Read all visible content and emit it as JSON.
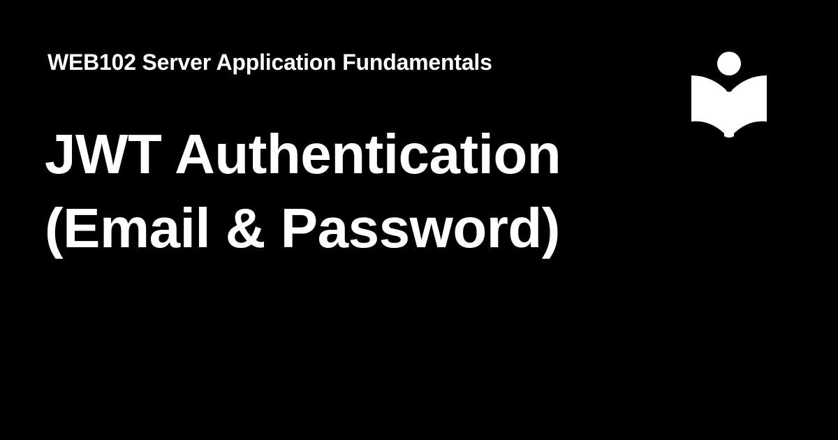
{
  "card": {
    "background_color": "#000000",
    "text_color": "#ffffff",
    "course_title": "WEB102 Server Application Fundamentals",
    "lesson_title": {
      "line1": "JWT Authentication",
      "line2": "(Email & Password)"
    },
    "logo_icon": "reader-book-icon"
  }
}
